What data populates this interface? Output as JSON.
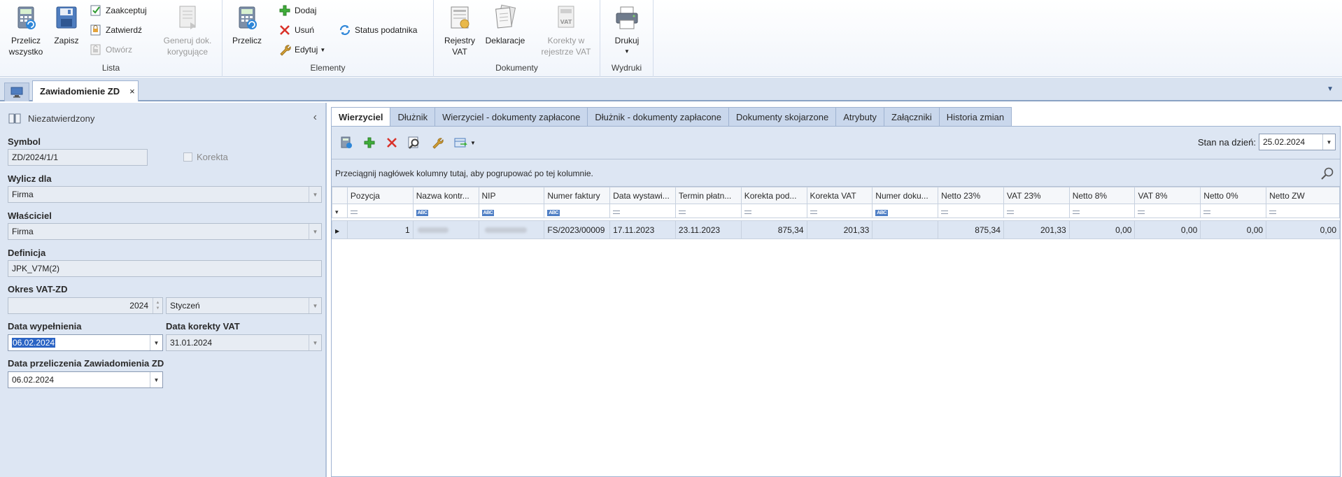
{
  "ribbon": {
    "groups": {
      "lista": "Lista",
      "elementy": "Elementy",
      "dokumenty": "Dokumenty",
      "wydruki": "Wydruki"
    },
    "przelicz_wszystko": [
      "Przelicz",
      "wszystko"
    ],
    "zapisz": "Zapisz",
    "zaakceptuj": "Zaakceptuj",
    "zatwierdz": "Zatwierdź",
    "otworz": "Otwórz",
    "generuj": [
      "Generuj dok.",
      "korygujące"
    ],
    "przelicz": "Przelicz",
    "dodaj": "Dodaj",
    "usun": "Usuń",
    "edytuj": "Edytuj",
    "status_podatnika": "Status podatnika",
    "rejestry_vat": [
      "Rejestry",
      "VAT"
    ],
    "deklaracje": "Deklaracje",
    "korekty": [
      "Korekty w",
      "rejestrze VAT"
    ],
    "drukuj": "Drukuj"
  },
  "doc_tab": {
    "title": "Zawiadomienie ZD",
    "close": "×"
  },
  "left": {
    "status": "Niezatwierdzony",
    "symbol_label": "Symbol",
    "symbol_value": "ZD/2024/1/1",
    "korekta_label": "Korekta",
    "wylicz_label": "Wylicz dla",
    "wylicz_value": "Firma",
    "wlasciciel_label": "Właściciel",
    "wlasciciel_value": "Firma",
    "definicja_label": "Definicja",
    "definicja_value": "JPK_V7M(2)",
    "okres_label": "Okres VAT-ZD",
    "okres_year": "2024",
    "okres_month": "Styczeń",
    "data_wyp_label": "Data wypełnienia",
    "data_wyp_value": "06.02.2024",
    "data_kor_label": "Data korekty VAT",
    "data_kor_value": "31.01.2024",
    "data_przel_label": "Data przeliczenia Zawiadomienia ZD",
    "data_przel_value": "06.02.2024"
  },
  "tabs": [
    "Wierzyciel",
    "Dłużnik",
    "Wierzyciel - dokumenty zapłacone",
    "Dłużnik - dokumenty zapłacone",
    "Dokumenty skojarzone",
    "Atrybuty",
    "Załączniki",
    "Historia zmian"
  ],
  "toolbar": {
    "icons": [
      "document-calc-icon",
      "add-icon",
      "delete-icon",
      "preview-icon",
      "edit-icon",
      "export-icon"
    ],
    "stan_label": "Stan na dzień:",
    "stan_value": "25.02.2024"
  },
  "grid": {
    "group_hint": "Przeciągnij nagłówek kolumny tutaj, aby pogrupować po tej kolumnie.",
    "columns": [
      "Pozycja",
      "Nazwa kontr...",
      "NIP",
      "Numer faktury",
      "Data wystawi...",
      "Termin płatn...",
      "Korekta pod...",
      "Korekta VAT",
      "Numer doku...",
      "Netto 23%",
      "VAT 23%",
      "Netto 8%",
      "VAT 8%",
      "Netto 0%",
      "Netto ZW"
    ],
    "filter_types": [
      "eq",
      "abc",
      "abc",
      "abc",
      "eq",
      "eq",
      "eq",
      "eq",
      "abc",
      "eq",
      "eq",
      "eq",
      "eq",
      "eq",
      "eq"
    ],
    "rows": [
      [
        "1",
        "",
        "",
        "FS/2023/00009",
        "17.11.2023",
        "23.11.2023",
        "875,34",
        "201,33",
        "",
        "875,34",
        "201,33",
        "0,00",
        "0,00",
        "0,00",
        "0,00"
      ]
    ]
  }
}
